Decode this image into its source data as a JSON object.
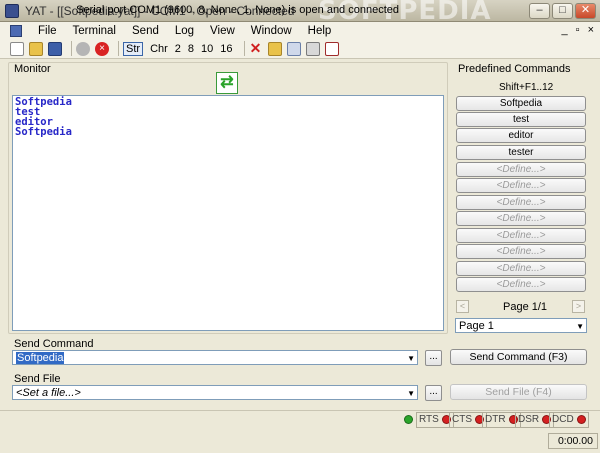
{
  "window": {
    "title": "YAT - [[Softpedia.yat]] - COM1 - Open - Connected",
    "watermark": "SOFTPEDIA",
    "minimize": "–",
    "maximize": "□",
    "close": "✕"
  },
  "menu": [
    "File",
    "Terminal",
    "Send",
    "Log",
    "View",
    "Window",
    "Help"
  ],
  "mdi": {
    "minimize": "_",
    "restore": "▫",
    "close": "×"
  },
  "toolbar": {
    "radix_labels": [
      "Str",
      "Chr",
      "2",
      "8",
      "10",
      "16"
    ]
  },
  "monitor": {
    "label": "Monitor",
    "swap_icon": "⇄",
    "lines": [
      "Softpedia",
      "test",
      "editor",
      "Softpedia"
    ]
  },
  "predefined": {
    "label": "Predefined Commands",
    "shortcut_hint": "Shift+F1..12",
    "buttons": [
      "Softpedia",
      "test",
      "editor",
      "tester",
      "<Define...>",
      "<Define...>",
      "<Define...>",
      "<Define...>",
      "<Define...>",
      "<Define...>",
      "<Define...>",
      "<Define...>"
    ],
    "page_label": "Page 1/1",
    "prev_arrow": "<",
    "next_arrow": ">",
    "page_select": "Page 1"
  },
  "send_command": {
    "label": "Send Command",
    "value": "Softpedia",
    "browse": "...",
    "button": "Send Command (F3)"
  },
  "send_file": {
    "label": "Send File",
    "value": "<Set a file...>",
    "browse": "...",
    "button": "Send File (F4)"
  },
  "status": {
    "text": "Serial port COM1 (9600, 8, None, 1, None) is open and connected",
    "connected_color": "#2aa52a",
    "signal_off_color": "#d42020",
    "signals": [
      "RTS",
      "CTS",
      "DTR",
      "DSR",
      "DCD"
    ],
    "timer": "0:00.00"
  }
}
